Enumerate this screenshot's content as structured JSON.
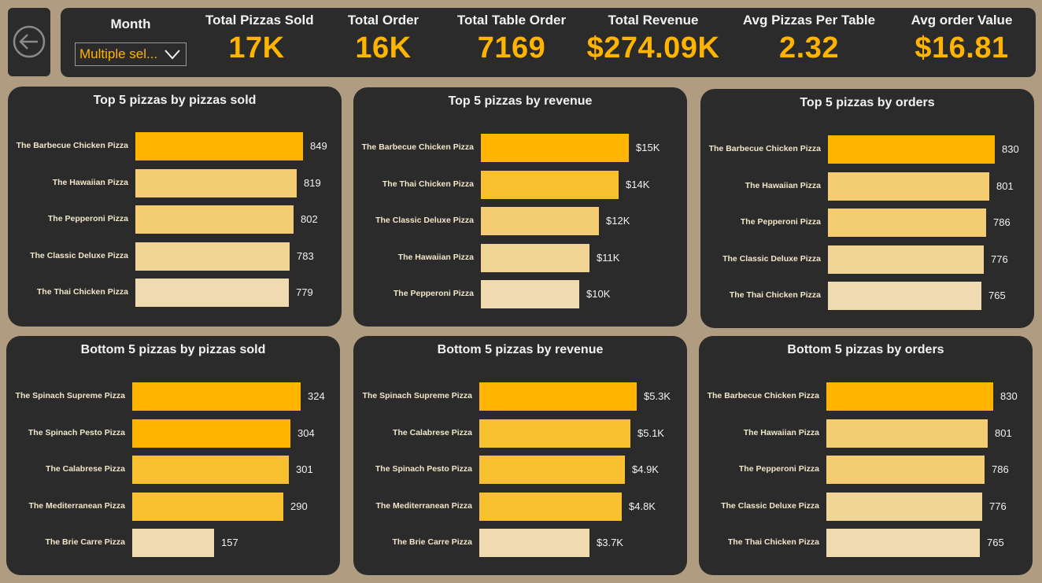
{
  "header": {
    "month_label": "Month",
    "month_value": "Multiple sel...",
    "kpis": [
      {
        "label": "Total Pizzas Sold",
        "value": "17K"
      },
      {
        "label": "Total Order",
        "value": "16K"
      },
      {
        "label": "Total Table Order",
        "value": "7169"
      },
      {
        "label": "Total Revenue",
        "value": "$274.09K"
      },
      {
        "label": "Avg Pizzas Per Table",
        "value": "2.32"
      },
      {
        "label": "Avg order Value",
        "value": "$16.81"
      }
    ]
  },
  "colors": {
    "shades": [
      "#ffb400",
      "#f9c12f",
      "#f4cd73",
      "#f1d596",
      "#f0dbb1"
    ]
  },
  "chart_data": [
    {
      "type": "bar",
      "title": "Top 5 pizzas by pizzas sold",
      "categories": [
        "The Barbecue Chicken Pizza",
        "The Hawaiian Pizza",
        "The Pepperoni Pizza",
        "The Classic Deluxe Pizza",
        "The Thai Chicken Pizza"
      ],
      "values": [
        849,
        819,
        802,
        783,
        779
      ],
      "labels": [
        "849",
        "819",
        "802",
        "783",
        "779"
      ],
      "max": 849
    },
    {
      "type": "bar",
      "title": "Top 5 pizzas by revenue",
      "categories": [
        "The Barbecue Chicken Pizza",
        "The Thai Chicken Pizza",
        "The Classic Deluxe Pizza",
        "The Hawaiian Pizza",
        "The Pepperoni Pizza"
      ],
      "values": [
        15000,
        14000,
        12000,
        11000,
        10000
      ],
      "labels": [
        "$15K",
        "$14K",
        "$12K",
        "$11K",
        "$10K"
      ],
      "max": 15000
    },
    {
      "type": "bar",
      "title": "Top 5 pizzas by orders",
      "categories": [
        "The Barbecue Chicken Pizza",
        "The Hawaiian Pizza",
        "The Pepperoni Pizza",
        "The Classic Deluxe Pizza",
        "The Thai Chicken Pizza"
      ],
      "values": [
        830,
        801,
        786,
        776,
        765
      ],
      "labels": [
        "830",
        "801",
        "786",
        "776",
        "765"
      ],
      "max": 830
    },
    {
      "type": "bar",
      "title": "Bottom 5 pizzas by pizzas sold",
      "categories": [
        "The Spinach Supreme Pizza",
        "The Spinach Pesto Pizza",
        "The Calabrese Pizza",
        "The Mediterranean Pizza",
        "The Brie Carre Pizza"
      ],
      "values": [
        324,
        304,
        301,
        290,
        157
      ],
      "labels": [
        "324",
        "304",
        "301",
        "290",
        "157"
      ],
      "max": 324
    },
    {
      "type": "bar",
      "title": "Bottom 5 pizzas by revenue",
      "categories": [
        "The Spinach Supreme Pizza",
        "The Calabrese Pizza",
        "The Spinach Pesto Pizza",
        "The Mediterranean Pizza",
        "The Brie Carre Pizza"
      ],
      "values": [
        5300,
        5100,
        4900,
        4800,
        3700
      ],
      "labels": [
        "$5.3K",
        "$5.1K",
        "$4.9K",
        "$4.8K",
        "$3.7K"
      ],
      "max": 5300
    },
    {
      "type": "bar",
      "title": "Bottom 5 pizzas by orders",
      "categories": [
        "The Barbecue Chicken Pizza",
        "The Hawaiian Pizza",
        "The Pepperoni Pizza",
        "The Classic Deluxe Pizza",
        "The Thai Chicken Pizza"
      ],
      "values": [
        830,
        801,
        786,
        776,
        765
      ],
      "labels": [
        "830",
        "801",
        "786",
        "776",
        "765"
      ],
      "max": 830
    }
  ]
}
